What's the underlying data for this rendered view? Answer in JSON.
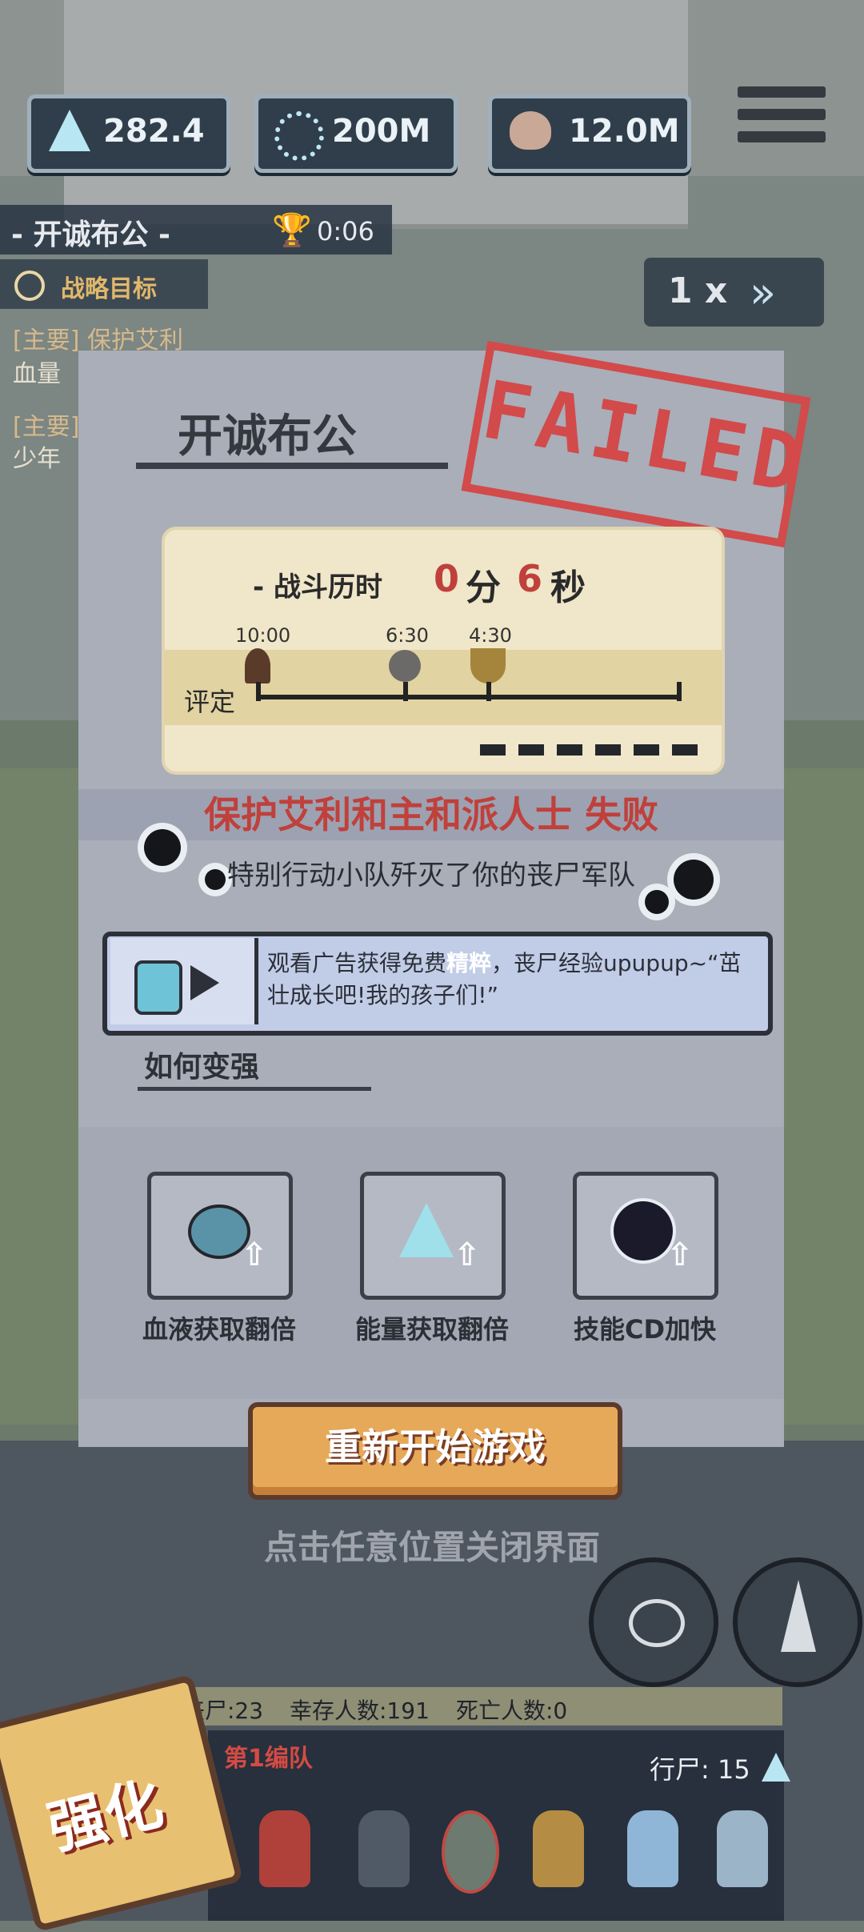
{
  "hud": {
    "resources": [
      {
        "name": "energy",
        "icon": "triangle-crystal-icon",
        "value": "282.4"
      },
      {
        "name": "dna",
        "icon": "dna-icon",
        "value": "200M"
      },
      {
        "name": "brain",
        "icon": "brain-icon",
        "value": "12.0M"
      }
    ],
    "level_name": "- 开诚布公 -",
    "timer": "0:06",
    "goal_label": "战略目标",
    "missions": [
      "[主要] 保护艾利",
      "血量",
      "[主要]",
      "少年"
    ],
    "speed": "1 x"
  },
  "dialog": {
    "title": "开诚布公",
    "stamp": "FAILED",
    "battle_time_label": "- 战斗历时",
    "minutes": "0",
    "minutes_unit": "分",
    "seconds": "6",
    "seconds_unit": "秒",
    "rating_label": "评定",
    "milestones": [
      "10:00",
      "6:30",
      "4:30"
    ],
    "fail_title": "保护艾利和主和派人士 失败",
    "fail_sub": "特别行动小队歼灭了你的丧尸军队",
    "ad_text_1": "观看广告获得免费",
    "ad_highlight": "精粹",
    "ad_text_2": "，丧尸经验upupup~“茁壮成长吧!我的孩子们!”",
    "how_title": "如何变强",
    "options": [
      {
        "label": "血液获取翻倍",
        "icon": "blood-flask-icon"
      },
      {
        "label": "能量获取翻倍",
        "icon": "energy-crystal-icon"
      },
      {
        "label": "技能CD加快",
        "icon": "dark-orb-icon"
      }
    ],
    "restart_label": "重新开始游戏",
    "close_hint": "点击任意位置关闭界面"
  },
  "bottom": {
    "zombies": "丧尸:23",
    "survivors": "幸存人数:191",
    "dead": "死亡人数:0",
    "squad_name": "第1编队",
    "walker": "行尸: 15",
    "boost_label": "强化"
  },
  "colors": {
    "fail_red": "#c0403b",
    "restart_orange": "#e6a95a",
    "highlight": "#ffffff"
  }
}
